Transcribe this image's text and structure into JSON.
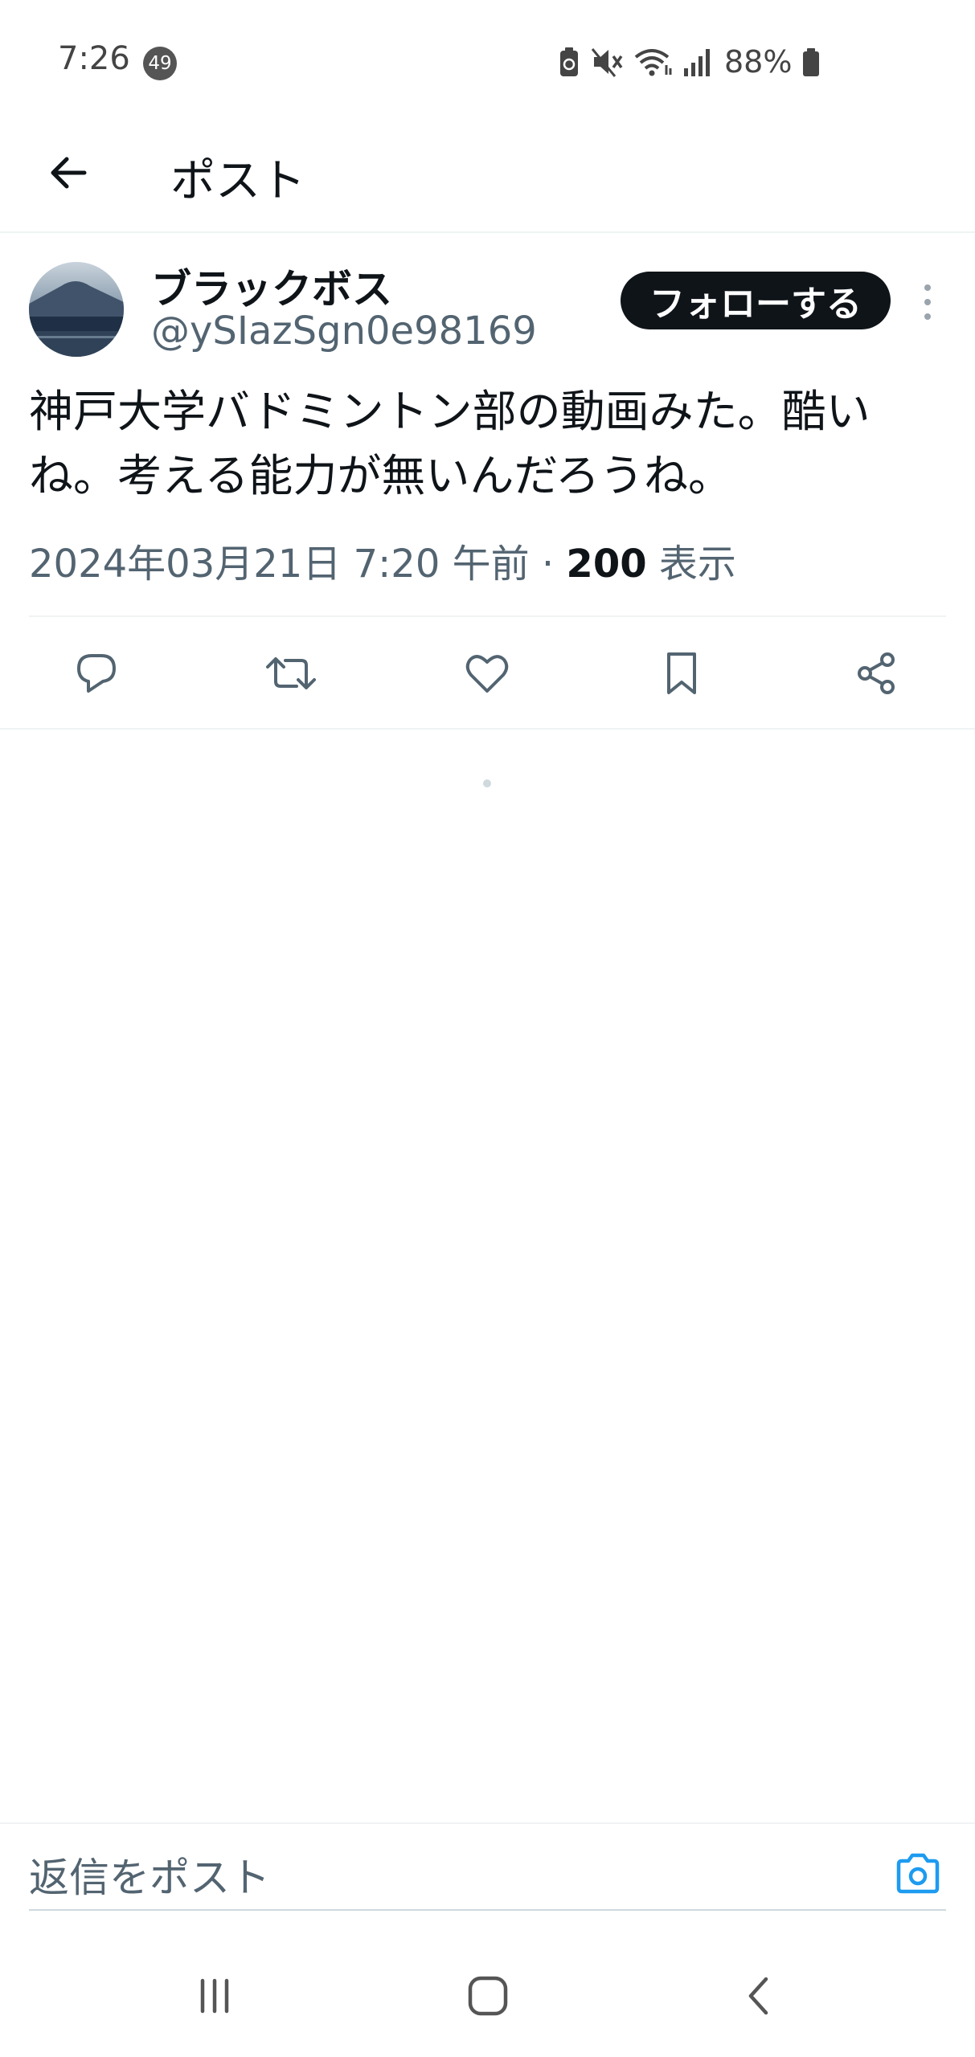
{
  "status_bar": {
    "time": "7:26",
    "notification_count": "49",
    "battery_percent": "88%",
    "icons": [
      "battery-saver-icon",
      "mute-icon",
      "wifi-icon",
      "signal-icon",
      "battery-icon"
    ]
  },
  "header": {
    "title": "ポスト",
    "back_icon": "arrow-left-icon"
  },
  "post": {
    "author_name": "ブラックボス",
    "author_handle": "@ySIazSgn0e98169",
    "follow_label": "フォローする",
    "text": "神戸大学バドミントン部の動画みた。酷いね。考える能力が無いんだろうね。",
    "timestamp": "2024年03月21日 7:20 午前",
    "separator": "·",
    "views_count": "200",
    "views_label": "表示",
    "actions": [
      "reply-icon",
      "repost-icon",
      "like-icon",
      "bookmark-icon",
      "share-icon"
    ]
  },
  "reply_bar": {
    "placeholder": "返信をポスト",
    "camera_icon": "camera-icon",
    "accent_color": "#1d9bf0"
  },
  "nav_bar": {
    "buttons": [
      "recent-apps-icon",
      "home-icon",
      "back-icon"
    ]
  }
}
